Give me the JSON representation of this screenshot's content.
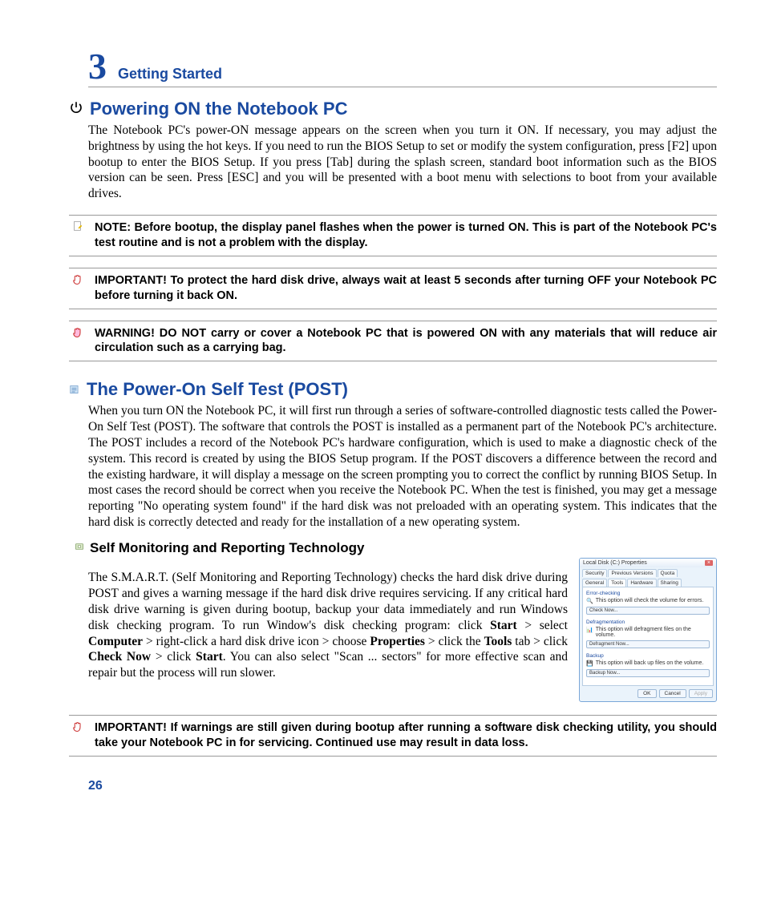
{
  "chapter": {
    "number": "3",
    "title": "Getting Started"
  },
  "section1": {
    "heading": "Powering ON the Notebook PC",
    "body": "The Notebook PC's power-ON message appears on the screen when you turn it ON. If necessary, you may adjust the brightness by using the hot keys. If you need to run the BIOS Setup to set or modify the system configuration, press [F2] upon bootup to enter the BIOS Setup. If you press [Tab] during the splash screen, standard boot information such as the BIOS version can be seen. Press [ESC] and you will be presented with a boot menu with selections to boot from your available drives."
  },
  "callouts": {
    "note": "NOTE:  Before bootup, the display panel flashes when the power is turned ON. This is part of the Notebook PC's test routine and is not a problem with the display.",
    "important1": "IMPORTANT!  To protect the hard disk drive, always wait at least 5 seconds after turning OFF your Notebook PC before turning it back ON.",
    "warning": "WARNING! DO NOT carry or cover a Notebook PC that is powered ON with any materials that will reduce air circulation such as a carrying bag.",
    "important2": "IMPORTANT! If warnings are still given during bootup after running a software disk checking utility, you should take your Notebook PC in for servicing. Continued use may result in data loss."
  },
  "section2": {
    "heading": "The Power-On Self Test (POST)",
    "body": "When you turn ON the Notebook PC, it will first run through a series of software-controlled diagnostic tests called the Power-On Self Test (POST). The software that controls the POST is installed as a permanent part of the Notebook PC's architecture. The POST includes a record of the Notebook PC's hardware configuration, which is used to make a diagnostic check of the system. This record is created by using the BIOS Setup program. If the POST discovers a difference between the record and the existing hardware, it will display a message on the screen prompting you to correct the conflict by running BIOS Setup. In most cases the record should be correct when you receive the Notebook PC. When the test is finished, you may get a message reporting \"No operating system found\" if the hard disk was not preloaded with an operating system. This indicates that the hard disk is correctly detected and ready for the installation of a new operating system."
  },
  "smart": {
    "heading": "Self Monitoring and Reporting Technology",
    "body_parts": [
      "The S.M.A.R.T. (Self Monitoring and Reporting Technology) checks the hard disk drive during POST and gives a warning message if the hard disk drive requires servicing. If any critical hard disk drive warning is given during bootup, backup your data immediately and run Windows disk checking program. To run Window's disk checking program: click ",
      "Start",
      " > select ",
      "Computer",
      " > right-click a hard disk drive icon > choose ",
      "Properties",
      " > click the ",
      "Tools",
      " tab > click ",
      "Check Now",
      " > click ",
      "Start",
      ". You can also select \"Scan ... sectors\" for more effective scan and repair but the process will run slower."
    ]
  },
  "dialog": {
    "title": "Local Disk (C:) Properties",
    "tabs_row1": [
      "Security",
      "Previous Versions",
      "Quota"
    ],
    "tabs_row2": [
      "General",
      "Tools",
      "Hardware",
      "Sharing"
    ],
    "groups": {
      "error": {
        "title": "Error-checking",
        "text": "This option will check the volume for errors.",
        "btn": "Check Now..."
      },
      "defrag": {
        "title": "Defragmentation",
        "text": "This option will defragment files on the volume.",
        "btn": "Defragment Now..."
      },
      "backup": {
        "title": "Backup",
        "text": "This option will back up files on the volume.",
        "btn": "Backup Now..."
      }
    },
    "footer": [
      "OK",
      "Cancel",
      "Apply"
    ]
  },
  "page_number": "26"
}
